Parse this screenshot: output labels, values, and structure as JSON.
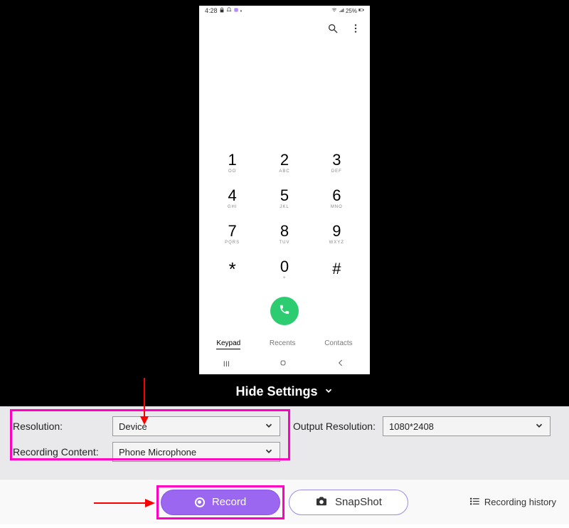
{
  "phone": {
    "status": {
      "time": "4:28",
      "battery_text": "25%"
    },
    "keys": [
      {
        "num": "1",
        "sub": "OO"
      },
      {
        "num": "2",
        "sub": "ABC"
      },
      {
        "num": "3",
        "sub": "DEF"
      },
      {
        "num": "4",
        "sub": "GHI"
      },
      {
        "num": "5",
        "sub": "JKL"
      },
      {
        "num": "6",
        "sub": "MNO"
      },
      {
        "num": "7",
        "sub": "PQRS"
      },
      {
        "num": "8",
        "sub": "TUV"
      },
      {
        "num": "9",
        "sub": "WXYZ"
      },
      {
        "num": "*",
        "sub": ""
      },
      {
        "num": "0",
        "sub": "+"
      },
      {
        "num": "#",
        "sub": ""
      }
    ],
    "tabs": {
      "keypad": "Keypad",
      "recents": "Recents",
      "contacts": "Contacts"
    }
  },
  "hide_settings": "Hide Settings",
  "settings": {
    "resolution_lbl": "Resolution:",
    "resolution_val": "Device",
    "recording_content_lbl": "Recording Content:",
    "recording_content_val": "Phone Microphone",
    "output_resolution_lbl": "Output Resolution:",
    "output_resolution_val": "1080*2408"
  },
  "buttons": {
    "record": "Record",
    "snapshot": "SnapShot",
    "history": "Recording history"
  },
  "colors": {
    "accent": "#9b66f0",
    "highlight": "#ff00c0",
    "arrow": "#ff0000",
    "call": "#2ecc71"
  }
}
